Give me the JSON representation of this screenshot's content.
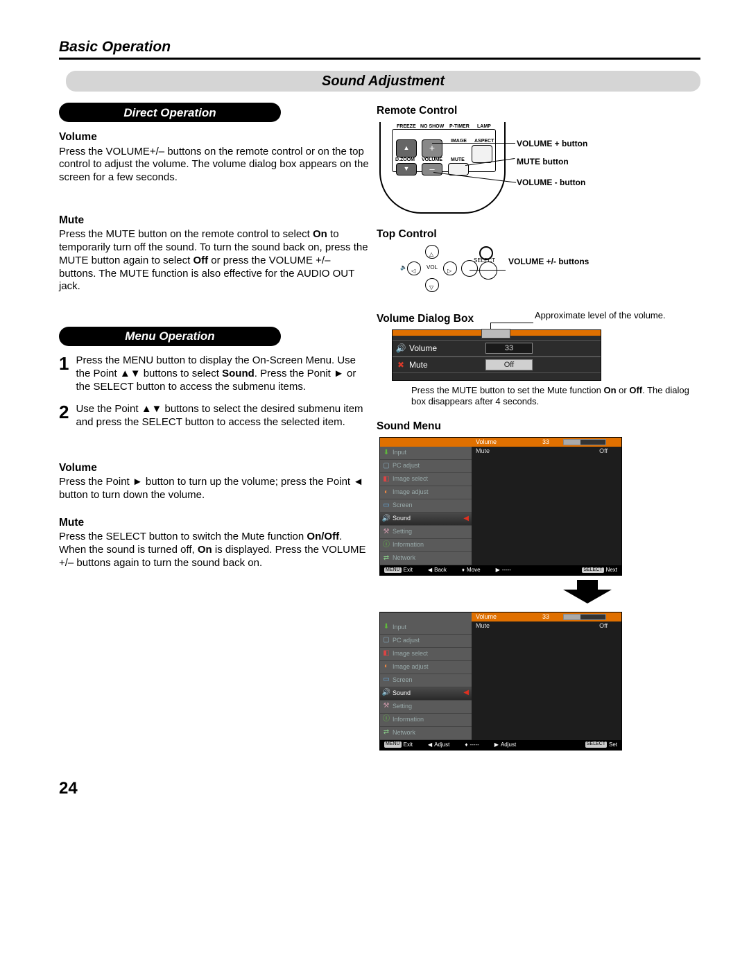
{
  "page": {
    "chapter": "Basic Operation",
    "section": "Sound Adjustment",
    "number": "24"
  },
  "left": {
    "direct_heading": "Direct Operation",
    "volume_h": "Volume",
    "volume_p": "Press the VOLUME+/– buttons on the remote control or on the top control to adjust the volume. The volume dialog box appears on the screen for a few seconds.",
    "mute_h": "Mute",
    "mute_p1": "Press the MUTE button on the remote control to select ",
    "mute_on": "On",
    "mute_p2": " to temporarily turn off the sound. To turn the sound back on, press the MUTE button again to select ",
    "mute_off": "Off",
    "mute_p3": " or press the VOLUME +/– buttons. The MUTE function is also effective for the AUDIO OUT jack.",
    "menu_heading": "Menu Operation",
    "step1": {
      "num": "1",
      "a": "Press the MENU button to display the On-Screen Menu. Use the Point ▲▼ buttons to select ",
      "b": "Sound",
      "c": ". Press the Ponit ► or the SELECT button to access the submenu items."
    },
    "step2": {
      "num": "2",
      "txt": "Use the Point ▲▼ buttons to select the desired submenu item and press the SELECT button to access the selected item."
    },
    "volume2_h": "Volume",
    "volume2_p": "Press the Point ► button to turn up the volume; press the Point ◄ button to turn down the volume.",
    "mute2_h": "Mute",
    "mute2_p1": "Press the SELECT button to switch the Mute function ",
    "mute2_onoff": "On/Off",
    "mute2_p2": ". When the sound is turned off, ",
    "mute2_on": "On",
    "mute2_p3": " is displayed. Press the VOLUME +/– buttons again to turn the sound back on."
  },
  "right": {
    "remote_h": "Remote Control",
    "remote_labels": {
      "freeze": "FREEZE",
      "noshow": "NO SHOW",
      "ptimer": "P-TIMER",
      "lamp": "LAMP",
      "image": "IMAGE",
      "aspect": "ASPECT",
      "dzoom": "D.ZOOM",
      "volume": "VOLUME",
      "mute": "MUTE"
    },
    "remote_btn": {
      "plus": "+",
      "minus": "–"
    },
    "callouts": {
      "vplus": "VOLUME + button",
      "mute": "MUTE button",
      "vminus": "VOLUME - button"
    },
    "top_h": "Top Control",
    "top_labels": {
      "select": "SELECT",
      "vol": "VOL"
    },
    "top_callout": "VOLUME +/- buttons",
    "vdb_h": "Volume Dialog Box",
    "vdb_annot": "Approximate level of the volume.",
    "vdb": {
      "volume_label": "Volume",
      "volume_value": "33",
      "mute_label": "Mute",
      "mute_value": "Off"
    },
    "vdb_caption1": "Press the MUTE button to set the Mute function ",
    "vdb_on": "On",
    "vdb_or": " or ",
    "vdb_off": "Off",
    "vdb_caption2": ". The dialog box disappears after 4 seconds.",
    "sound_h": "Sound Menu",
    "menu": {
      "side": [
        "Input",
        "PC adjust",
        "Image select",
        "Image adjust",
        "Screen",
        "Sound",
        "Setting",
        "Information",
        "Network"
      ],
      "head_vol": "Volume",
      "head_vol_val": "33",
      "head_mute": "Mute",
      "head_mute_val": "Off"
    },
    "footer": {
      "exit": "Exit",
      "back": "Back",
      "move": "Move",
      "dashes": "-----",
      "next": "Next",
      "adjust": "Adjust",
      "set": "Set"
    },
    "footer_badge": {
      "menu": "MENU",
      "select": "SELECT"
    }
  }
}
